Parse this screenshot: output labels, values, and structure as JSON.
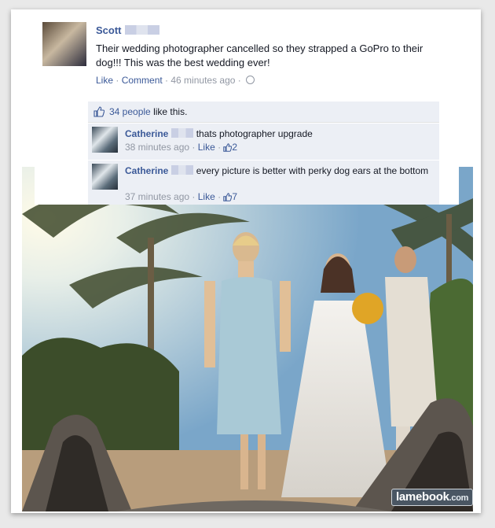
{
  "post": {
    "author": "Scott",
    "text": "Their wedding photographer cancelled so they strapped a GoPro to their dog!!! This was the best wedding ever!",
    "actions": {
      "like": "Like",
      "comment": "Comment",
      "time": "46 minutes ago"
    },
    "likes_count": "34 people",
    "likes_suffix": "like this."
  },
  "comments": [
    {
      "author": "Catherine",
      "text": "thats photographer upgrade",
      "time": "38 minutes ago",
      "like": "Like",
      "likes": "2"
    },
    {
      "author": "Catherine",
      "text": "every picture is better with perky dog ears at the bottom",
      "time": "37 minutes ago",
      "like": "Like",
      "likes": "7"
    }
  ],
  "watermark": {
    "brand": "lamebook",
    "suffix": ".com"
  },
  "icons": [
    "thumbs-up-icon",
    "globe-icon"
  ],
  "colors": {
    "link": "#3b5998",
    "muted": "#9197a3",
    "ufi_bg": "#eceff5"
  }
}
